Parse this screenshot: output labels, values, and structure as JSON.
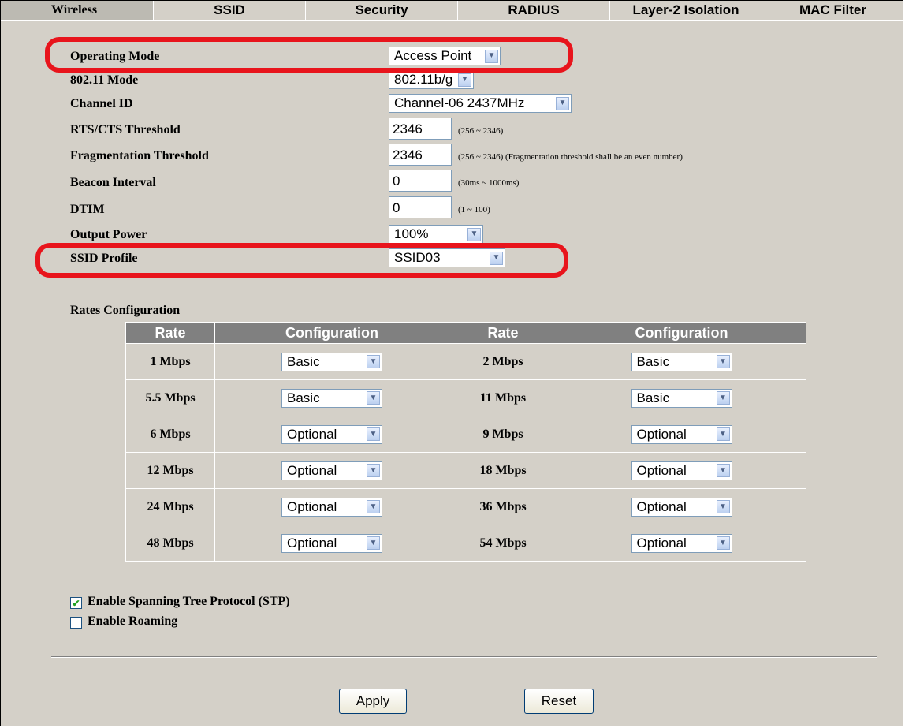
{
  "tabs": [
    "Wireless",
    "SSID",
    "Security",
    "RADIUS",
    "Layer-2 Isolation",
    "MAC Filter"
  ],
  "fields": {
    "operating_mode": {
      "label": "Operating Mode",
      "value": "Access Point"
    },
    "mode_80211": {
      "label": "802.11 Mode",
      "value": "802.11b/g"
    },
    "channel_id": {
      "label": "Channel ID",
      "value": "Channel-06 2437MHz"
    },
    "rts_cts": {
      "label": "RTS/CTS Threshold",
      "value": "2346",
      "hint": "(256 ~ 2346)"
    },
    "fragmentation": {
      "label": "Fragmentation Threshold",
      "value": "2346",
      "hint": "(256 ~ 2346) (Fragmentation threshold shall be an even number)"
    },
    "beacon_interval": {
      "label": "Beacon Interval",
      "value": "0",
      "hint": "(30ms ~ 1000ms)"
    },
    "dtim": {
      "label": "DTIM",
      "value": "0",
      "hint": "(1 ~ 100)"
    },
    "output_power": {
      "label": "Output Power",
      "value": "100%"
    },
    "ssid_profile": {
      "label": "SSID Profile",
      "value": "SSID03"
    }
  },
  "rates": {
    "title": "Rates Configuration",
    "headers": [
      "Rate",
      "Configuration",
      "Rate",
      "Configuration"
    ],
    "rows": [
      {
        "rate1": "1 Mbps",
        "config1": "Basic",
        "rate2": "2 Mbps",
        "config2": "Basic"
      },
      {
        "rate1": "5.5 Mbps",
        "config1": "Basic",
        "rate2": "11 Mbps",
        "config2": "Basic"
      },
      {
        "rate1": "6 Mbps",
        "config1": "Optional",
        "rate2": "9 Mbps",
        "config2": "Optional"
      },
      {
        "rate1": "12 Mbps",
        "config1": "Optional",
        "rate2": "18 Mbps",
        "config2": "Optional"
      },
      {
        "rate1": "24 Mbps",
        "config1": "Optional",
        "rate2": "36 Mbps",
        "config2": "Optional"
      },
      {
        "rate1": "48 Mbps",
        "config1": "Optional",
        "rate2": "54 Mbps",
        "config2": "Optional"
      }
    ]
  },
  "options": {
    "stp": {
      "label": "Enable Spanning Tree Protocol (STP)",
      "checked": true
    },
    "roaming": {
      "label": "Enable Roaming",
      "checked": false
    }
  },
  "buttons": {
    "apply": "Apply",
    "reset": "Reset"
  },
  "colors": {
    "highlight": "#e8141c",
    "table_header": "#808080",
    "panel": "#d4d0c8"
  }
}
